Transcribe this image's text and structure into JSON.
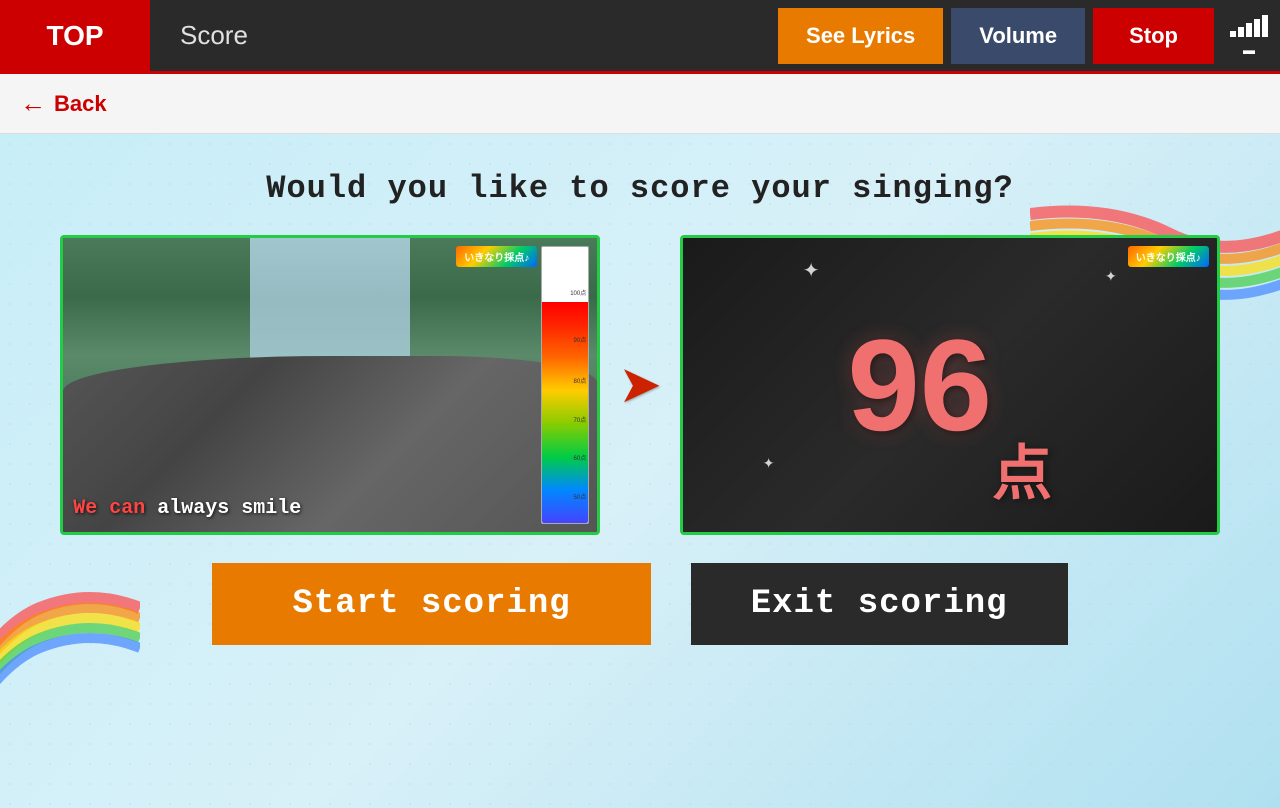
{
  "header": {
    "top_label": "TOP",
    "score_label": "Score",
    "see_lyrics_label": "See Lyrics",
    "volume_label": "Volume",
    "stop_label": "Stop"
  },
  "navigation": {
    "back_label": "Back"
  },
  "main": {
    "question": "Would you like to score your singing?",
    "arrow": "➤",
    "left_card": {
      "badge": "いきなり採点♪",
      "lyrics_highlighted": "We can",
      "lyrics_plain": " always smile",
      "score_bar_top": "100点",
      "score_ticks": [
        "90点",
        "80点",
        "70点",
        "60点",
        "50点"
      ]
    },
    "right_card": {
      "badge": "いきなり採点♪",
      "score_number": "96",
      "score_unit": "点"
    }
  },
  "buttons": {
    "start_scoring": "Start scoring",
    "exit_scoring": "Exit scoring"
  }
}
